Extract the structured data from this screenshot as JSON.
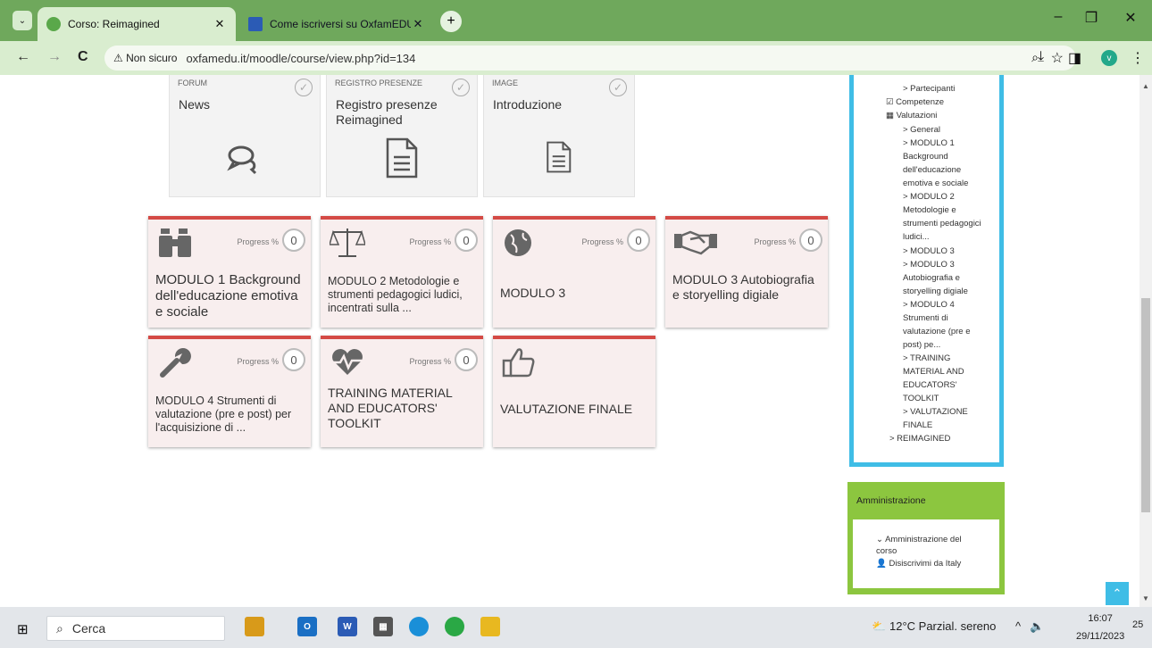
{
  "browser": {
    "tab_active": "Corso: Reimagined",
    "tab_inactive": "Come iscriversi su OxfamEDU.i",
    "insecure": "Non sicuro",
    "url": "oxfamedu.it/moodle/course/view.php?id=134",
    "avatar_letter": "v"
  },
  "activities": [
    {
      "type": "FORUM",
      "name": "News"
    },
    {
      "type": "REGISTRO PRESENZE",
      "name": "Registro presenze Reimagined"
    },
    {
      "type": "IMAGE",
      "name": "Introduzione"
    }
  ],
  "progress_label": "Progress %",
  "modules": [
    {
      "title": "MODULO 1 Background dell'educazione emotiva e sociale",
      "progress": "0",
      "icon": "binoculars-icon"
    },
    {
      "title": "MODULO 2 Metodologie e strumenti pedagogici ludici, incentrati sulla ...",
      "progress": "0",
      "icon": "scale-icon"
    },
    {
      "title": "MODULO 3",
      "progress": "0",
      "icon": "globe-icon"
    },
    {
      "title": "MODULO 3 Autobiografia e storyelling digiale",
      "progress": "0",
      "icon": "handshake-icon"
    },
    {
      "title": "MODULO 4 Strumenti di valutazione (pre e post) per l'acquisizione di ...",
      "progress": "0",
      "icon": "wrench-icon"
    },
    {
      "title": "TRAINING MATERIAL AND EDUCATORS' TOOLKIT",
      "progress": "0",
      "icon": "heartbeat-icon"
    },
    {
      "title": "VALUTAZIONE FINALE",
      "progress": "",
      "icon": "thumbs-up-icon"
    }
  ],
  "nav": {
    "partial_top": "...",
    "partecipanti": "> Partecipanti",
    "competenze": "Competenze",
    "valutazioni": "Valutazioni",
    "general": "> General",
    "m1a": "> MODULO 1",
    "m1b": "Background",
    "m1c": "dell'educazione",
    "m1d": "emotiva e sociale",
    "m2a": "> MODULO 2",
    "m2b": "Metodologie e",
    "m2c": "strumenti pedagogici",
    "m2d": "ludici...",
    "m3": "> MODULO 3",
    "m3ba": "> MODULO 3",
    "m3bb": "Autobiografia e",
    "m3bc": "storyelling digiale",
    "m4a": "> MODULO 4",
    "m4b": "Strumenti di",
    "m4c": "valutazione (pre e",
    "m4d": "post) pe...",
    "tra": "> TRAINING",
    "trb": "MATERIAL AND",
    "trc": "EDUCATORS'",
    "trd": "TOOLKIT",
    "vfa": "> VALUTAZIONE",
    "vfb": "FINALE",
    "reimagined": "> REIMAGINED"
  },
  "admin": {
    "title": "Amministrazione",
    "course_admin_1": "Amministrazione del",
    "course_admin_2": "corso",
    "unenrol": "Disiscrivimi da Italy"
  },
  "taskbar": {
    "search": "Cerca",
    "weather": "12°C  Parzial. sereno",
    "time": "16:07",
    "date": "29/11/2023",
    "notif": "25"
  }
}
